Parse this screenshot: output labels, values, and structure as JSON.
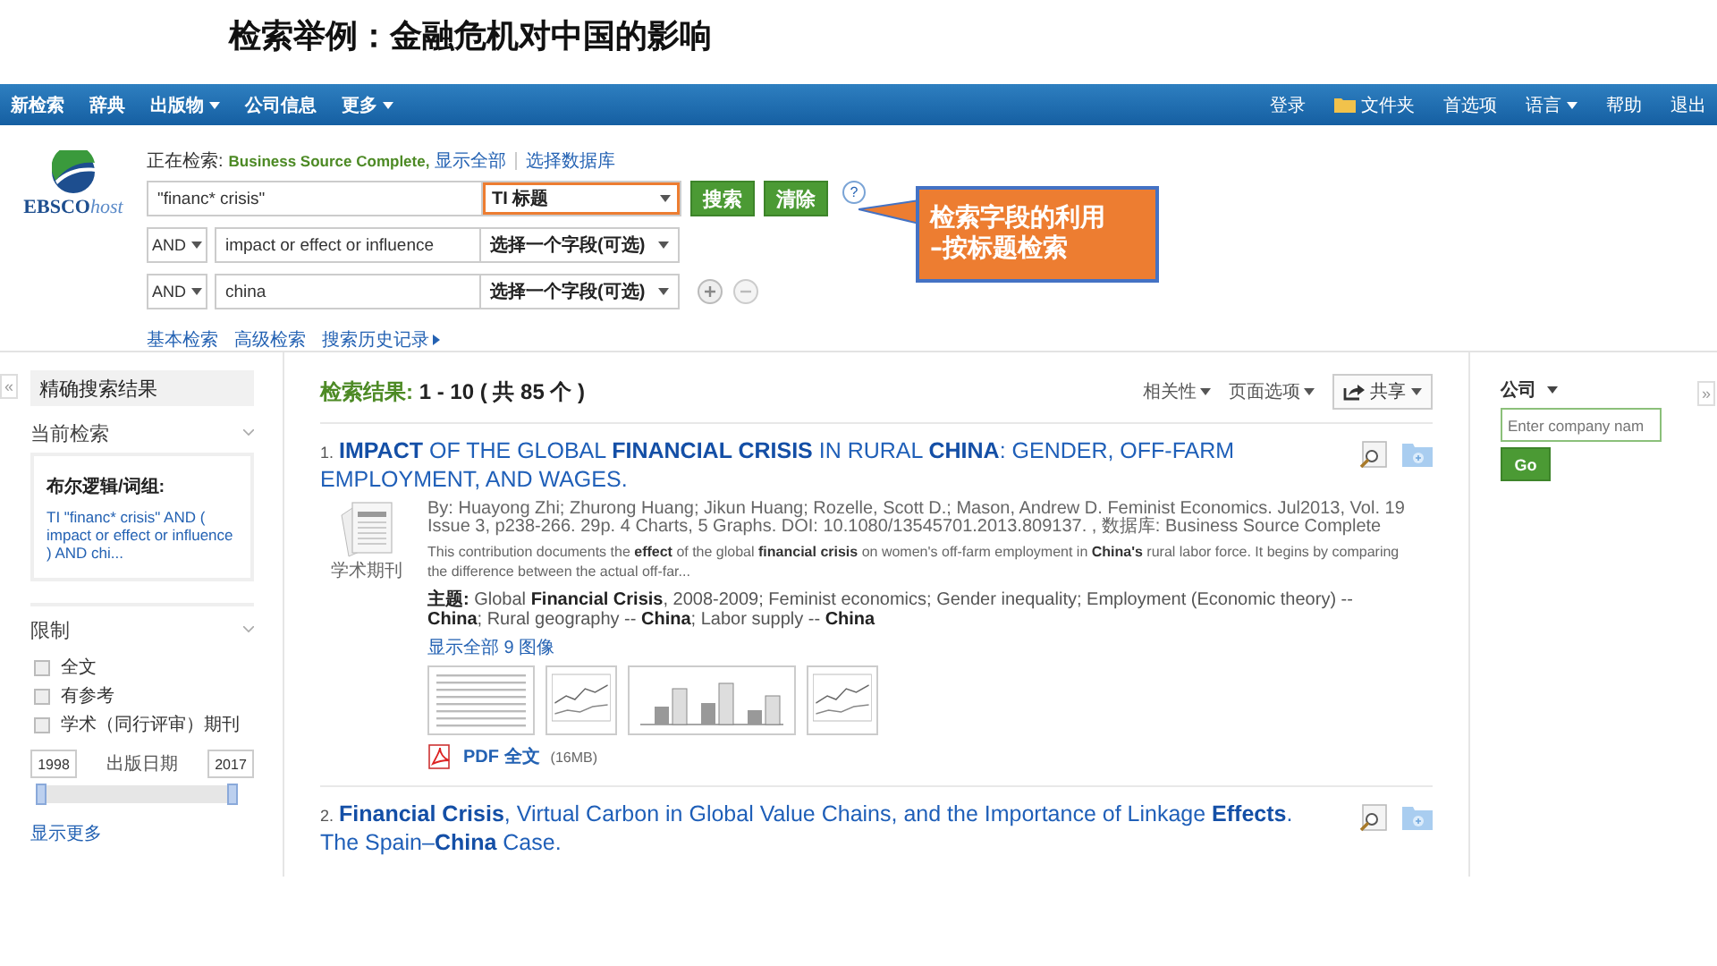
{
  "slide_title": "检索举例：金融危机对中国的影响",
  "nav": {
    "left": [
      {
        "label": "新检索",
        "dropdown": false
      },
      {
        "label": "辞典",
        "dropdown": false
      },
      {
        "label": "出版物",
        "dropdown": true
      },
      {
        "label": "公司信息",
        "dropdown": false
      },
      {
        "label": "更多",
        "dropdown": true
      }
    ],
    "right": [
      {
        "label": "登录",
        "kind": "link",
        "dropdown": false
      },
      {
        "label": "文件夹",
        "kind": "folder",
        "dropdown": false
      },
      {
        "label": "首选项",
        "kind": "link",
        "dropdown": false
      },
      {
        "label": "语言",
        "kind": "link",
        "dropdown": true
      },
      {
        "label": "帮助",
        "kind": "link",
        "dropdown": false
      },
      {
        "label": "退出",
        "kind": "link",
        "dropdown": false
      }
    ]
  },
  "logo": {
    "main": "EBSCO",
    "suffix": "host"
  },
  "search": {
    "searching_label": "正在检索:",
    "database": "Business Source Complete,",
    "show_all": "显示全部",
    "choose_db": "选择数据库",
    "rows": [
      {
        "value": "\"financ* crisis\"",
        "field": "TI 标题",
        "highlighted": true
      },
      {
        "operator": "AND",
        "value": "impact or effect or influence",
        "field": "选择一个字段(可选)",
        "highlighted": false
      },
      {
        "operator": "AND",
        "value": "china",
        "field": "选择一个字段(可选)",
        "highlighted": false
      }
    ],
    "search_button": "搜索",
    "clear_button": "清除",
    "help": "?",
    "links": [
      {
        "label": "基本检索",
        "arrow": false
      },
      {
        "label": "高级检索",
        "arrow": false
      },
      {
        "label": "搜索历史记录",
        "arrow": true
      }
    ]
  },
  "callout": {
    "lines": [
      "检索字段的利用",
      "–按标题检索"
    ]
  },
  "sidebar": {
    "collapse": "«",
    "title": "精确搜索结果",
    "current_heading": "当前检索",
    "boolean_label": "布尔逻辑/词组:",
    "query": "TI \"financ* crisis\" AND ( impact or effect or influence ) AND chi...",
    "limits_heading": "限制",
    "options": [
      {
        "label": "全文",
        "checked": false
      },
      {
        "label": "有参考",
        "checked": false
      },
      {
        "label": "学术（同行评审）期刊",
        "checked": false
      }
    ],
    "date_from": "1998",
    "date_label": "出版日期",
    "date_to": "2017",
    "date_slider": {
      "level": 1
    },
    "show_more": "显示更多"
  },
  "results": {
    "label": "检索结果:",
    "range": "1 - 10 ( 共 85 个 )",
    "sort": "相关性",
    "page_options": "页面选项",
    "share": "共享",
    "items": [
      {
        "number": "1.",
        "title": "**IMPACT** OF THE GLOBAL **FINANCIAL CRISIS** IN RURAL **CHINA**: GENDER, OFF-FARM EMPLOYMENT, AND WAGES.",
        "type": "学术期刊",
        "meta": "By: Huayong Zhi; Zhurong Huang; Jikun Huang; Rozelle, Scott D.; Mason, Andrew D. Feminist Economics. Jul2013, Vol. 19 Issue 3, p238-266. 29p. 4 Charts, 5 Graphs. DOI: 10.1080/13545701.2013.809137. , 数据库: Business Source Complete",
        "abstract": "This contribution documents the **effect** of the global **financial crisis** on women's off-farm employment in **China's** rural labor force. It begins by comparing the difference between the actual off-far...",
        "subjects": "**主题:** Global **Financial Crisis**, 2008-2009; Feminist economics; Gender inequality; Employment (Economic theory) -- **China**; Rural geography -- **China**; Labor supply -- **China**",
        "images_link": "显示全部 9 图像",
        "thumbnails": [
          {
            "kind": "table"
          },
          {
            "kind": "line"
          },
          {
            "kind": "bar"
          },
          {
            "kind": "line"
          }
        ],
        "pdf": "PDF 全文",
        "pdf_size": "(16MB)"
      },
      {
        "number": "2.",
        "title": "**Financial Crisis**, Virtual Carbon in Global Value Chains, and the Importance of Linkage **Effects**. The Spain–**China** Case."
      }
    ]
  },
  "company": {
    "label": "公司",
    "placeholder": "Enter company nam",
    "button": "Go",
    "expand": "»"
  }
}
